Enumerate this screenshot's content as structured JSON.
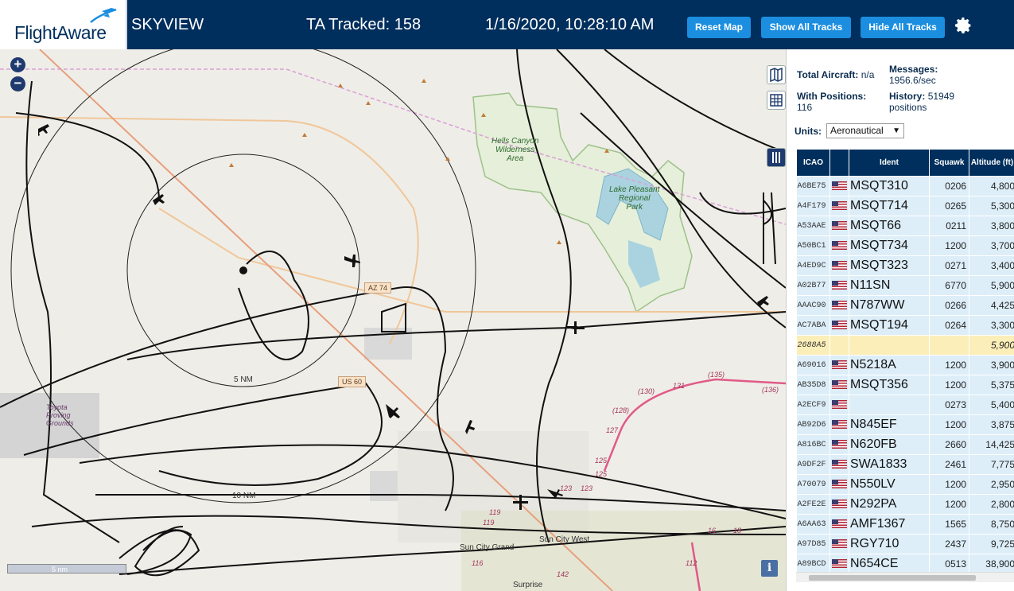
{
  "header": {
    "logo_text": "FlightAware",
    "site_name": "SKYVIEW",
    "tracked": "TA Tracked: 158",
    "datetime": "1/16/2020, 10:28:10 AM",
    "buttons": {
      "reset": "Reset Map",
      "show_all": "Show All Tracks",
      "hide_all": "Hide All Tracks"
    },
    "settings_icon": "gear-icon"
  },
  "map": {
    "zoom_in": "+",
    "zoom_out": "−",
    "range_labels": {
      "r5": "5 NM",
      "r10": "10 NM"
    },
    "scale_label": "5 nm",
    "info": "i",
    "labels": {
      "hells_canyon": "Hells Canyon\nWilderness\nArea",
      "lake_pleasant": "Lake Pleasant\nRegional\nPark",
      "toyota": "Toyota\nProving\nGrounds",
      "sun_city_grand": "Sun City Grand",
      "sun_city_west": "Sun City West",
      "surprise": "Surprise",
      "az74": "AZ 74",
      "us60": "US 60"
    },
    "road_numbers": [
      "(135)",
      "(136)",
      "(130)",
      "131",
      "(128)",
      "127",
      "125",
      "125",
      "123",
      "123",
      "119",
      "119",
      "116",
      "142",
      "112",
      "18",
      "16"
    ]
  },
  "panel": {
    "total_aircraft_label": "Total Aircraft:",
    "total_aircraft_value": "n/a",
    "messages_label": "Messages:",
    "messages_value": "1956.6/sec",
    "with_positions_label": "With Positions:",
    "with_positions_value": "116",
    "history_label": "History:",
    "history_value": "51949",
    "history_unit": "positions",
    "units_label": "Units:",
    "units_value": "Aeronautical",
    "columns": [
      "ICAO",
      "",
      "Ident",
      "Squawk",
      "Altitude (ft)"
    ],
    "rows": [
      {
        "icao": "A6BE75",
        "flag": true,
        "ident": "MSQT310",
        "squawk": "0206",
        "alt": "4,800"
      },
      {
        "icao": "A4F179",
        "flag": true,
        "ident": "MSQT714",
        "squawk": "0265",
        "alt": "5,300"
      },
      {
        "icao": "A53AAE",
        "flag": true,
        "ident": "MSQT66",
        "squawk": "0211",
        "alt": "3,800"
      },
      {
        "icao": "A50BC1",
        "flag": true,
        "ident": "MSQT734",
        "squawk": "1200",
        "alt": "3,700"
      },
      {
        "icao": "A4ED9C",
        "flag": true,
        "ident": "MSQT323",
        "squawk": "0271",
        "alt": "3,400"
      },
      {
        "icao": "A02B77",
        "flag": true,
        "ident": "N11SN",
        "squawk": "6770",
        "alt": "5,900"
      },
      {
        "icao": "AAAC90",
        "flag": true,
        "ident": "N787WW",
        "squawk": "0266",
        "alt": "4,425"
      },
      {
        "icao": "AC7ABA",
        "flag": true,
        "ident": "MSQT194",
        "squawk": "0264",
        "alt": "3,300"
      },
      {
        "icao": "2688A5",
        "flag": false,
        "ident": "",
        "squawk": "",
        "alt": "5,900",
        "highlight": true
      },
      {
        "icao": "A69016",
        "flag": true,
        "ident": "N5218A",
        "squawk": "1200",
        "alt": "3,900"
      },
      {
        "icao": "AB35D8",
        "flag": true,
        "ident": "MSQT356",
        "squawk": "1200",
        "alt": "5,375"
      },
      {
        "icao": "A2ECF9",
        "flag": true,
        "ident": "",
        "squawk": "0273",
        "alt": "5,400"
      },
      {
        "icao": "AB92D6",
        "flag": true,
        "ident": "N845EF",
        "squawk": "1200",
        "alt": "3,875"
      },
      {
        "icao": "A816BC",
        "flag": true,
        "ident": "N620FB",
        "squawk": "2660",
        "alt": "14,425"
      },
      {
        "icao": "A9DF2F",
        "flag": true,
        "ident": "SWA1833",
        "squawk": "2461",
        "alt": "7,775"
      },
      {
        "icao": "A70079",
        "flag": true,
        "ident": "N550LV",
        "squawk": "1200",
        "alt": "2,950"
      },
      {
        "icao": "A2FE2E",
        "flag": true,
        "ident": "N292PA",
        "squawk": "1200",
        "alt": "2,800"
      },
      {
        "icao": "A6AA63",
        "flag": true,
        "ident": "AMF1367",
        "squawk": "1565",
        "alt": "8,750"
      },
      {
        "icao": "A97D85",
        "flag": true,
        "ident": "RGY710",
        "squawk": "2437",
        "alt": "9,725"
      },
      {
        "icao": "A89BCD",
        "flag": true,
        "ident": "N654CE",
        "squawk": "0513",
        "alt": "38,900"
      }
    ]
  }
}
